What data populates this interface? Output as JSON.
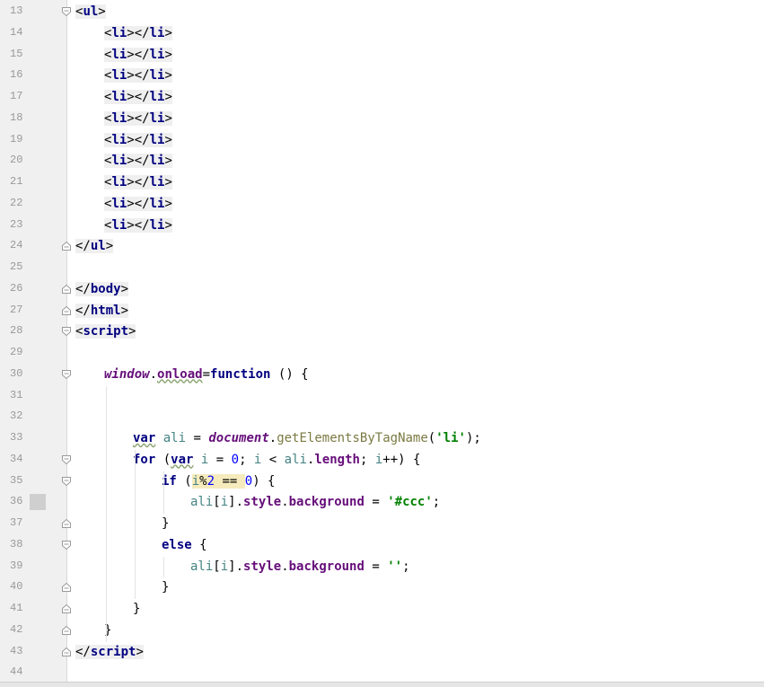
{
  "editor": {
    "lines": [
      {
        "n": "13",
        "fold": "open",
        "tokens": [
          {
            "t": "<",
            "c": "br tagbg"
          },
          {
            "t": "ul",
            "c": "tag tagbg"
          },
          {
            "t": ">",
            "c": "br tagbg"
          }
        ],
        "indent": 0
      },
      {
        "n": "14",
        "tokens": [
          {
            "t": "<",
            "c": "br tagbg"
          },
          {
            "t": "li",
            "c": "tag tagbg"
          },
          {
            "t": "></",
            "c": "br tagbg"
          },
          {
            "t": "li",
            "c": "tag tagbg"
          },
          {
            "t": ">",
            "c": "br tagbg"
          }
        ],
        "indent": 1
      },
      {
        "n": "15",
        "tokens": [
          {
            "t": "<",
            "c": "br tagbg"
          },
          {
            "t": "li",
            "c": "tag tagbg"
          },
          {
            "t": "></",
            "c": "br tagbg"
          },
          {
            "t": "li",
            "c": "tag tagbg"
          },
          {
            "t": ">",
            "c": "br tagbg"
          }
        ],
        "indent": 1
      },
      {
        "n": "16",
        "tokens": [
          {
            "t": "<",
            "c": "br tagbg"
          },
          {
            "t": "li",
            "c": "tag tagbg"
          },
          {
            "t": "></",
            "c": "br tagbg"
          },
          {
            "t": "li",
            "c": "tag tagbg"
          },
          {
            "t": ">",
            "c": "br tagbg"
          }
        ],
        "indent": 1
      },
      {
        "n": "17",
        "tokens": [
          {
            "t": "<",
            "c": "br tagbg"
          },
          {
            "t": "li",
            "c": "tag tagbg"
          },
          {
            "t": "></",
            "c": "br tagbg"
          },
          {
            "t": "li",
            "c": "tag tagbg"
          },
          {
            "t": ">",
            "c": "br tagbg"
          }
        ],
        "indent": 1
      },
      {
        "n": "18",
        "tokens": [
          {
            "t": "<",
            "c": "br tagbg"
          },
          {
            "t": "li",
            "c": "tag tagbg"
          },
          {
            "t": "></",
            "c": "br tagbg"
          },
          {
            "t": "li",
            "c": "tag tagbg"
          },
          {
            "t": ">",
            "c": "br tagbg"
          }
        ],
        "indent": 1
      },
      {
        "n": "19",
        "tokens": [
          {
            "t": "<",
            "c": "br tagbg"
          },
          {
            "t": "li",
            "c": "tag tagbg"
          },
          {
            "t": "></",
            "c": "br tagbg"
          },
          {
            "t": "li",
            "c": "tag tagbg"
          },
          {
            "t": ">",
            "c": "br tagbg"
          }
        ],
        "indent": 1
      },
      {
        "n": "20",
        "tokens": [
          {
            "t": "<",
            "c": "br tagbg"
          },
          {
            "t": "li",
            "c": "tag tagbg"
          },
          {
            "t": "></",
            "c": "br tagbg"
          },
          {
            "t": "li",
            "c": "tag tagbg"
          },
          {
            "t": ">",
            "c": "br tagbg"
          }
        ],
        "indent": 1
      },
      {
        "n": "21",
        "tokens": [
          {
            "t": "<",
            "c": "br tagbg"
          },
          {
            "t": "li",
            "c": "tag tagbg"
          },
          {
            "t": "></",
            "c": "br tagbg"
          },
          {
            "t": "li",
            "c": "tag tagbg"
          },
          {
            "t": ">",
            "c": "br tagbg"
          }
        ],
        "indent": 1
      },
      {
        "n": "22",
        "tokens": [
          {
            "t": "<",
            "c": "br tagbg"
          },
          {
            "t": "li",
            "c": "tag tagbg"
          },
          {
            "t": "></",
            "c": "br tagbg"
          },
          {
            "t": "li",
            "c": "tag tagbg"
          },
          {
            "t": ">",
            "c": "br tagbg"
          }
        ],
        "indent": 1
      },
      {
        "n": "23",
        "tokens": [
          {
            "t": "<",
            "c": "br tagbg"
          },
          {
            "t": "li",
            "c": "tag tagbg"
          },
          {
            "t": "></",
            "c": "br tagbg"
          },
          {
            "t": "li",
            "c": "tag tagbg"
          },
          {
            "t": ">",
            "c": "br tagbg"
          }
        ],
        "indent": 1
      },
      {
        "n": "24",
        "fold": "close",
        "tokens": [
          {
            "t": "</",
            "c": "br tagbg"
          },
          {
            "t": "ul",
            "c": "tag tagbg"
          },
          {
            "t": ">",
            "c": "br tagbg"
          }
        ],
        "indent": 0
      },
      {
        "n": "25",
        "tokens": [],
        "indent": 0
      },
      {
        "n": "26",
        "fold": "close",
        "tokens": [
          {
            "t": "</",
            "c": "br tagbg"
          },
          {
            "t": "body",
            "c": "tag tagbg"
          },
          {
            "t": ">",
            "c": "br tagbg"
          }
        ],
        "indent": 0
      },
      {
        "n": "27",
        "fold": "close",
        "tokens": [
          {
            "t": "</",
            "c": "br tagbg"
          },
          {
            "t": "html",
            "c": "tag tagbg"
          },
          {
            "t": ">",
            "c": "br tagbg"
          }
        ],
        "indent": 0
      },
      {
        "n": "28",
        "fold": "open",
        "tokens": [
          {
            "t": "<",
            "c": "br tagbg"
          },
          {
            "t": "script",
            "c": "tag tagbg"
          },
          {
            "t": ">",
            "c": "br tagbg"
          }
        ],
        "indent": 0
      },
      {
        "n": "29",
        "tokens": [],
        "indent": 0
      },
      {
        "n": "30",
        "fold": "open",
        "tokens": [
          {
            "t": "window",
            "c": "glob"
          },
          {
            "t": ".",
            "c": ""
          },
          {
            "t": "onload",
            "c": "prop squig"
          },
          {
            "t": "=",
            "c": ""
          },
          {
            "t": "function",
            "c": "kw"
          },
          {
            "t": " () {",
            "c": ""
          }
        ],
        "indent": 1
      },
      {
        "n": "31",
        "tokens": [],
        "indent": 0
      },
      {
        "n": "32",
        "tokens": [],
        "indent": 0
      },
      {
        "n": "33",
        "tokens": [
          {
            "t": "var",
            "c": "kw squig"
          },
          {
            "t": " ",
            "c": ""
          },
          {
            "t": "ali",
            "c": "var"
          },
          {
            "t": " = ",
            "c": ""
          },
          {
            "t": "document",
            "c": "glob"
          },
          {
            "t": ".",
            "c": ""
          },
          {
            "t": "getElementsByTagName",
            "c": "meth"
          },
          {
            "t": "(",
            "c": ""
          },
          {
            "t": "'li'",
            "c": "str"
          },
          {
            "t": ");",
            "c": ""
          }
        ],
        "indent": 2
      },
      {
        "n": "34",
        "fold": "open",
        "tokens": [
          {
            "t": "for",
            "c": "kw"
          },
          {
            "t": " (",
            "c": ""
          },
          {
            "t": "var",
            "c": "kw squig"
          },
          {
            "t": " ",
            "c": ""
          },
          {
            "t": "i",
            "c": "var"
          },
          {
            "t": " = ",
            "c": ""
          },
          {
            "t": "0",
            "c": "num"
          },
          {
            "t": "; ",
            "c": ""
          },
          {
            "t": "i",
            "c": "var"
          },
          {
            "t": " < ",
            "c": ""
          },
          {
            "t": "ali",
            "c": "var"
          },
          {
            "t": ".",
            "c": ""
          },
          {
            "t": "length",
            "c": "prop"
          },
          {
            "t": "; ",
            "c": ""
          },
          {
            "t": "i",
            "c": "var"
          },
          {
            "t": "++) {",
            "c": ""
          }
        ],
        "indent": 2
      },
      {
        "n": "35",
        "fold": "open",
        "tokens": [
          {
            "t": "if",
            "c": "kw"
          },
          {
            "t": " (",
            "c": ""
          },
          {
            "t": "i",
            "c": "var hl"
          },
          {
            "t": "%",
            "c": "hl"
          },
          {
            "t": "2",
            "c": "num hl"
          },
          {
            "t": " == ",
            "c": "hl"
          },
          {
            "t": "0",
            "c": "num"
          },
          {
            "t": ") {",
            "c": ""
          }
        ],
        "indent": 3
      },
      {
        "n": "36",
        "bp": true,
        "tokens": [
          {
            "t": "ali",
            "c": "var"
          },
          {
            "t": "[",
            "c": ""
          },
          {
            "t": "i",
            "c": "var"
          },
          {
            "t": "].",
            "c": ""
          },
          {
            "t": "style",
            "c": "prop"
          },
          {
            "t": ".",
            "c": ""
          },
          {
            "t": "background",
            "c": "prop"
          },
          {
            "t": " = ",
            "c": ""
          },
          {
            "t": "'#ccc'",
            "c": "str"
          },
          {
            "t": ";",
            "c": ""
          }
        ],
        "indent": 4
      },
      {
        "n": "37",
        "fold": "close",
        "tokens": [
          {
            "t": "}",
            "c": ""
          }
        ],
        "indent": 3
      },
      {
        "n": "38",
        "fold": "open2",
        "tokens": [
          {
            "t": "else",
            "c": "kw"
          },
          {
            "t": " {",
            "c": ""
          }
        ],
        "indent": 3
      },
      {
        "n": "39",
        "tokens": [
          {
            "t": "ali",
            "c": "var"
          },
          {
            "t": "[",
            "c": ""
          },
          {
            "t": "i",
            "c": "var"
          },
          {
            "t": "].",
            "c": ""
          },
          {
            "t": "style",
            "c": "prop"
          },
          {
            "t": ".",
            "c": ""
          },
          {
            "t": "background",
            "c": "prop"
          },
          {
            "t": " = ",
            "c": ""
          },
          {
            "t": "''",
            "c": "str"
          },
          {
            "t": ";",
            "c": ""
          }
        ],
        "indent": 4
      },
      {
        "n": "40",
        "fold": "close2",
        "tokens": [
          {
            "t": "}",
            "c": ""
          }
        ],
        "indent": 3
      },
      {
        "n": "41",
        "fold": "close",
        "tokens": [
          {
            "t": "}",
            "c": ""
          }
        ],
        "indent": 2
      },
      {
        "n": "42",
        "fold": "close",
        "tokens": [
          {
            "t": "}",
            "c": ""
          }
        ],
        "indent": 1
      },
      {
        "n": "43",
        "fold": "close",
        "tokens": [
          {
            "t": "</",
            "c": "br tagbg"
          },
          {
            "t": "script",
            "c": "tag tagbg"
          },
          {
            "t": ">",
            "c": "br tagbg"
          }
        ],
        "indent": 0
      },
      {
        "n": "44",
        "tokens": [],
        "indent": 0
      }
    ]
  },
  "colors": {
    "tag": "#000080",
    "keyword": "#000080",
    "global": "#660e7a",
    "method": "#7a7a43",
    "variable": "#458383",
    "number": "#0000ff",
    "string": "#008000",
    "gutter_bg": "#f0f0f0",
    "highlight": "#f6ebbc"
  }
}
